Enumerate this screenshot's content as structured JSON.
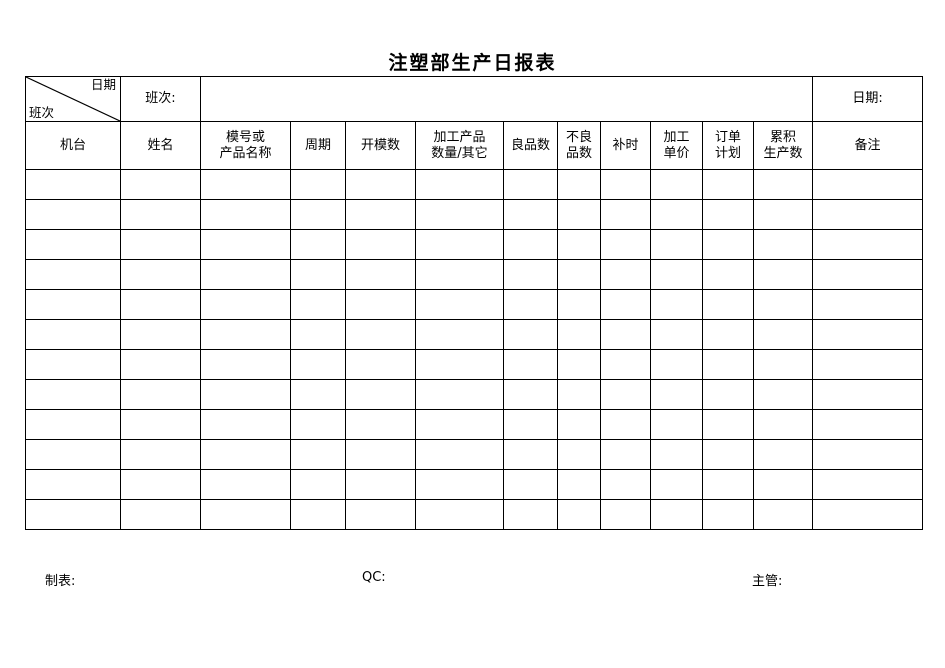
{
  "document": {
    "title": "注塑部生产日报表"
  },
  "header": {
    "corner_cell": {
      "top_right_label": "日期",
      "bottom_left_label": "班次"
    },
    "shift_label": "班次:",
    "shift_value": "",
    "date_label": "日期:",
    "date_value": ""
  },
  "table": {
    "columns": [
      {
        "key": "machine",
        "label": "机台",
        "line1": "机台",
        "line2": ""
      },
      {
        "key": "name",
        "label": "姓名",
        "line1": "姓名",
        "line2": ""
      },
      {
        "key": "mold_or_product",
        "label": "模号或产品名称",
        "line1": "模号或",
        "line2": "产品名称"
      },
      {
        "key": "cycle",
        "label": "周期",
        "line1": "周期",
        "line2": ""
      },
      {
        "key": "mold_open_count",
        "label": "开模数",
        "line1": "开模数",
        "line2": ""
      },
      {
        "key": "processed_qty",
        "label": "加工产品数量/其它",
        "line1": "加工产品",
        "line2": "数量/其它"
      },
      {
        "key": "good_qty",
        "label": "良品数",
        "line1": "良品数",
        "line2": ""
      },
      {
        "key": "defect_qty",
        "label": "不良品数",
        "line1": "不良",
        "line2": "品数"
      },
      {
        "key": "extra_time",
        "label": "补时",
        "line1": "补时",
        "line2": ""
      },
      {
        "key": "unit_price",
        "label": "加工单价",
        "line1": "加工",
        "line2": "单价"
      },
      {
        "key": "order_plan",
        "label": "订单计划",
        "line1": "订单",
        "line2": "计划"
      },
      {
        "key": "cumulative_qty",
        "label": "累积生产数",
        "line1": "累积",
        "line2": "生产数"
      },
      {
        "key": "remarks",
        "label": "备注",
        "line1": "备注",
        "line2": ""
      }
    ],
    "rows": [
      {
        "machine": "",
        "name": "",
        "mold_or_product": "",
        "cycle": "",
        "mold_open_count": "",
        "processed_qty": "",
        "good_qty": "",
        "defect_qty": "",
        "extra_time": "",
        "unit_price": "",
        "order_plan": "",
        "cumulative_qty": "",
        "remarks": ""
      },
      {
        "machine": "",
        "name": "",
        "mold_or_product": "",
        "cycle": "",
        "mold_open_count": "",
        "processed_qty": "",
        "good_qty": "",
        "defect_qty": "",
        "extra_time": "",
        "unit_price": "",
        "order_plan": "",
        "cumulative_qty": "",
        "remarks": ""
      },
      {
        "machine": "",
        "name": "",
        "mold_or_product": "",
        "cycle": "",
        "mold_open_count": "",
        "processed_qty": "",
        "good_qty": "",
        "defect_qty": "",
        "extra_time": "",
        "unit_price": "",
        "order_plan": "",
        "cumulative_qty": "",
        "remarks": ""
      },
      {
        "machine": "",
        "name": "",
        "mold_or_product": "",
        "cycle": "",
        "mold_open_count": "",
        "processed_qty": "",
        "good_qty": "",
        "defect_qty": "",
        "extra_time": "",
        "unit_price": "",
        "order_plan": "",
        "cumulative_qty": "",
        "remarks": ""
      },
      {
        "machine": "",
        "name": "",
        "mold_or_product": "",
        "cycle": "",
        "mold_open_count": "",
        "processed_qty": "",
        "good_qty": "",
        "defect_qty": "",
        "extra_time": "",
        "unit_price": "",
        "order_plan": "",
        "cumulative_qty": "",
        "remarks": ""
      },
      {
        "machine": "",
        "name": "",
        "mold_or_product": "",
        "cycle": "",
        "mold_open_count": "",
        "processed_qty": "",
        "good_qty": "",
        "defect_qty": "",
        "extra_time": "",
        "unit_price": "",
        "order_plan": "",
        "cumulative_qty": "",
        "remarks": ""
      },
      {
        "machine": "",
        "name": "",
        "mold_or_product": "",
        "cycle": "",
        "mold_open_count": "",
        "processed_qty": "",
        "good_qty": "",
        "defect_qty": "",
        "extra_time": "",
        "unit_price": "",
        "order_plan": "",
        "cumulative_qty": "",
        "remarks": ""
      },
      {
        "machine": "",
        "name": "",
        "mold_or_product": "",
        "cycle": "",
        "mold_open_count": "",
        "processed_qty": "",
        "good_qty": "",
        "defect_qty": "",
        "extra_time": "",
        "unit_price": "",
        "order_plan": "",
        "cumulative_qty": "",
        "remarks": ""
      },
      {
        "machine": "",
        "name": "",
        "mold_or_product": "",
        "cycle": "",
        "mold_open_count": "",
        "processed_qty": "",
        "good_qty": "",
        "defect_qty": "",
        "extra_time": "",
        "unit_price": "",
        "order_plan": "",
        "cumulative_qty": "",
        "remarks": ""
      },
      {
        "machine": "",
        "name": "",
        "mold_or_product": "",
        "cycle": "",
        "mold_open_count": "",
        "processed_qty": "",
        "good_qty": "",
        "defect_qty": "",
        "extra_time": "",
        "unit_price": "",
        "order_plan": "",
        "cumulative_qty": "",
        "remarks": ""
      },
      {
        "machine": "",
        "name": "",
        "mold_or_product": "",
        "cycle": "",
        "mold_open_count": "",
        "processed_qty": "",
        "good_qty": "",
        "defect_qty": "",
        "extra_time": "",
        "unit_price": "",
        "order_plan": "",
        "cumulative_qty": "",
        "remarks": ""
      },
      {
        "machine": "",
        "name": "",
        "mold_or_product": "",
        "cycle": "",
        "mold_open_count": "",
        "processed_qty": "",
        "good_qty": "",
        "defect_qty": "",
        "extra_time": "",
        "unit_price": "",
        "order_plan": "",
        "cumulative_qty": "",
        "remarks": ""
      }
    ]
  },
  "footer": {
    "prepared_by_label": "制表:",
    "qc_label": "QC:",
    "supervisor_label": "主管:"
  },
  "colors": {
    "border": "#000000",
    "text": "#000000",
    "background": "#ffffff"
  }
}
